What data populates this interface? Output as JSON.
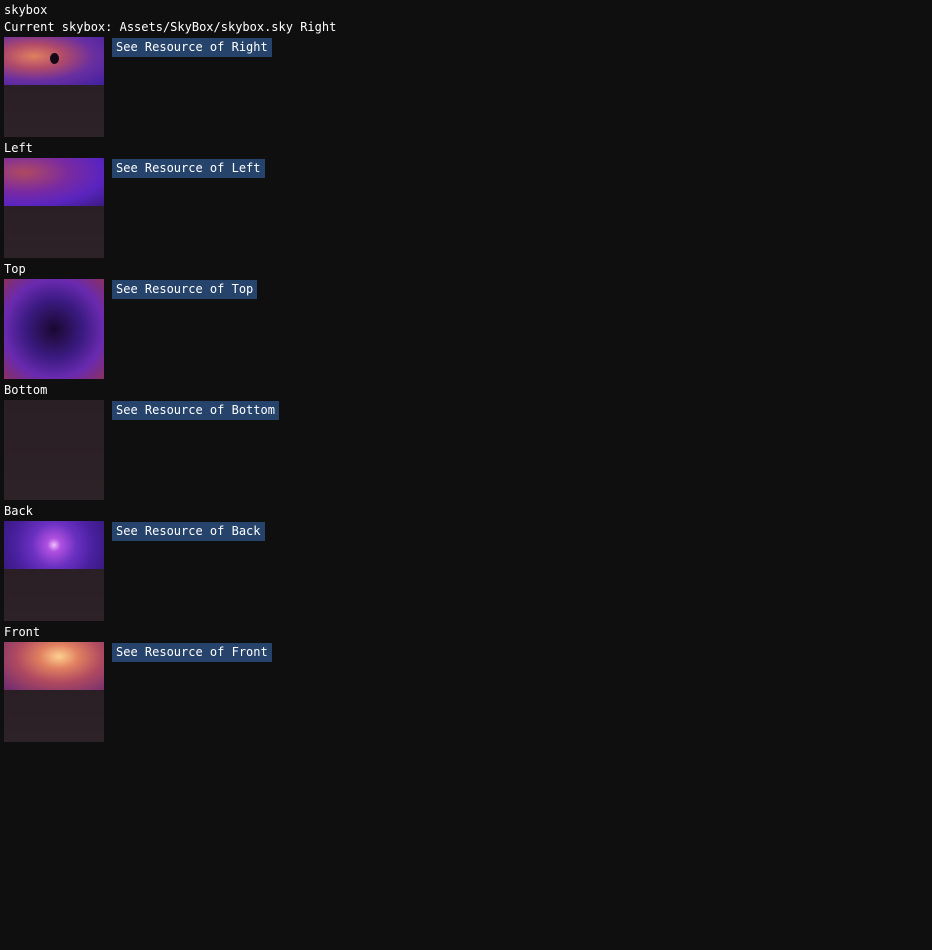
{
  "window_title": "skybox",
  "current_line": "Current skybox: Assets/SkyBox/skybox.sky Right",
  "faces": [
    {
      "label": "Right",
      "button": "See Resource of Right"
    },
    {
      "label": "Left",
      "button": "See Resource of Left"
    },
    {
      "label": "Top",
      "button": "See Resource of Top"
    },
    {
      "label": "Bottom",
      "button": "See Resource of Bottom"
    },
    {
      "label": "Back",
      "button": "See Resource of Back"
    },
    {
      "label": "Front",
      "button": "See Resource of Front"
    }
  ],
  "colors": {
    "background": "#0f0f0f",
    "button": "#26436b",
    "text": "#ffffff"
  }
}
